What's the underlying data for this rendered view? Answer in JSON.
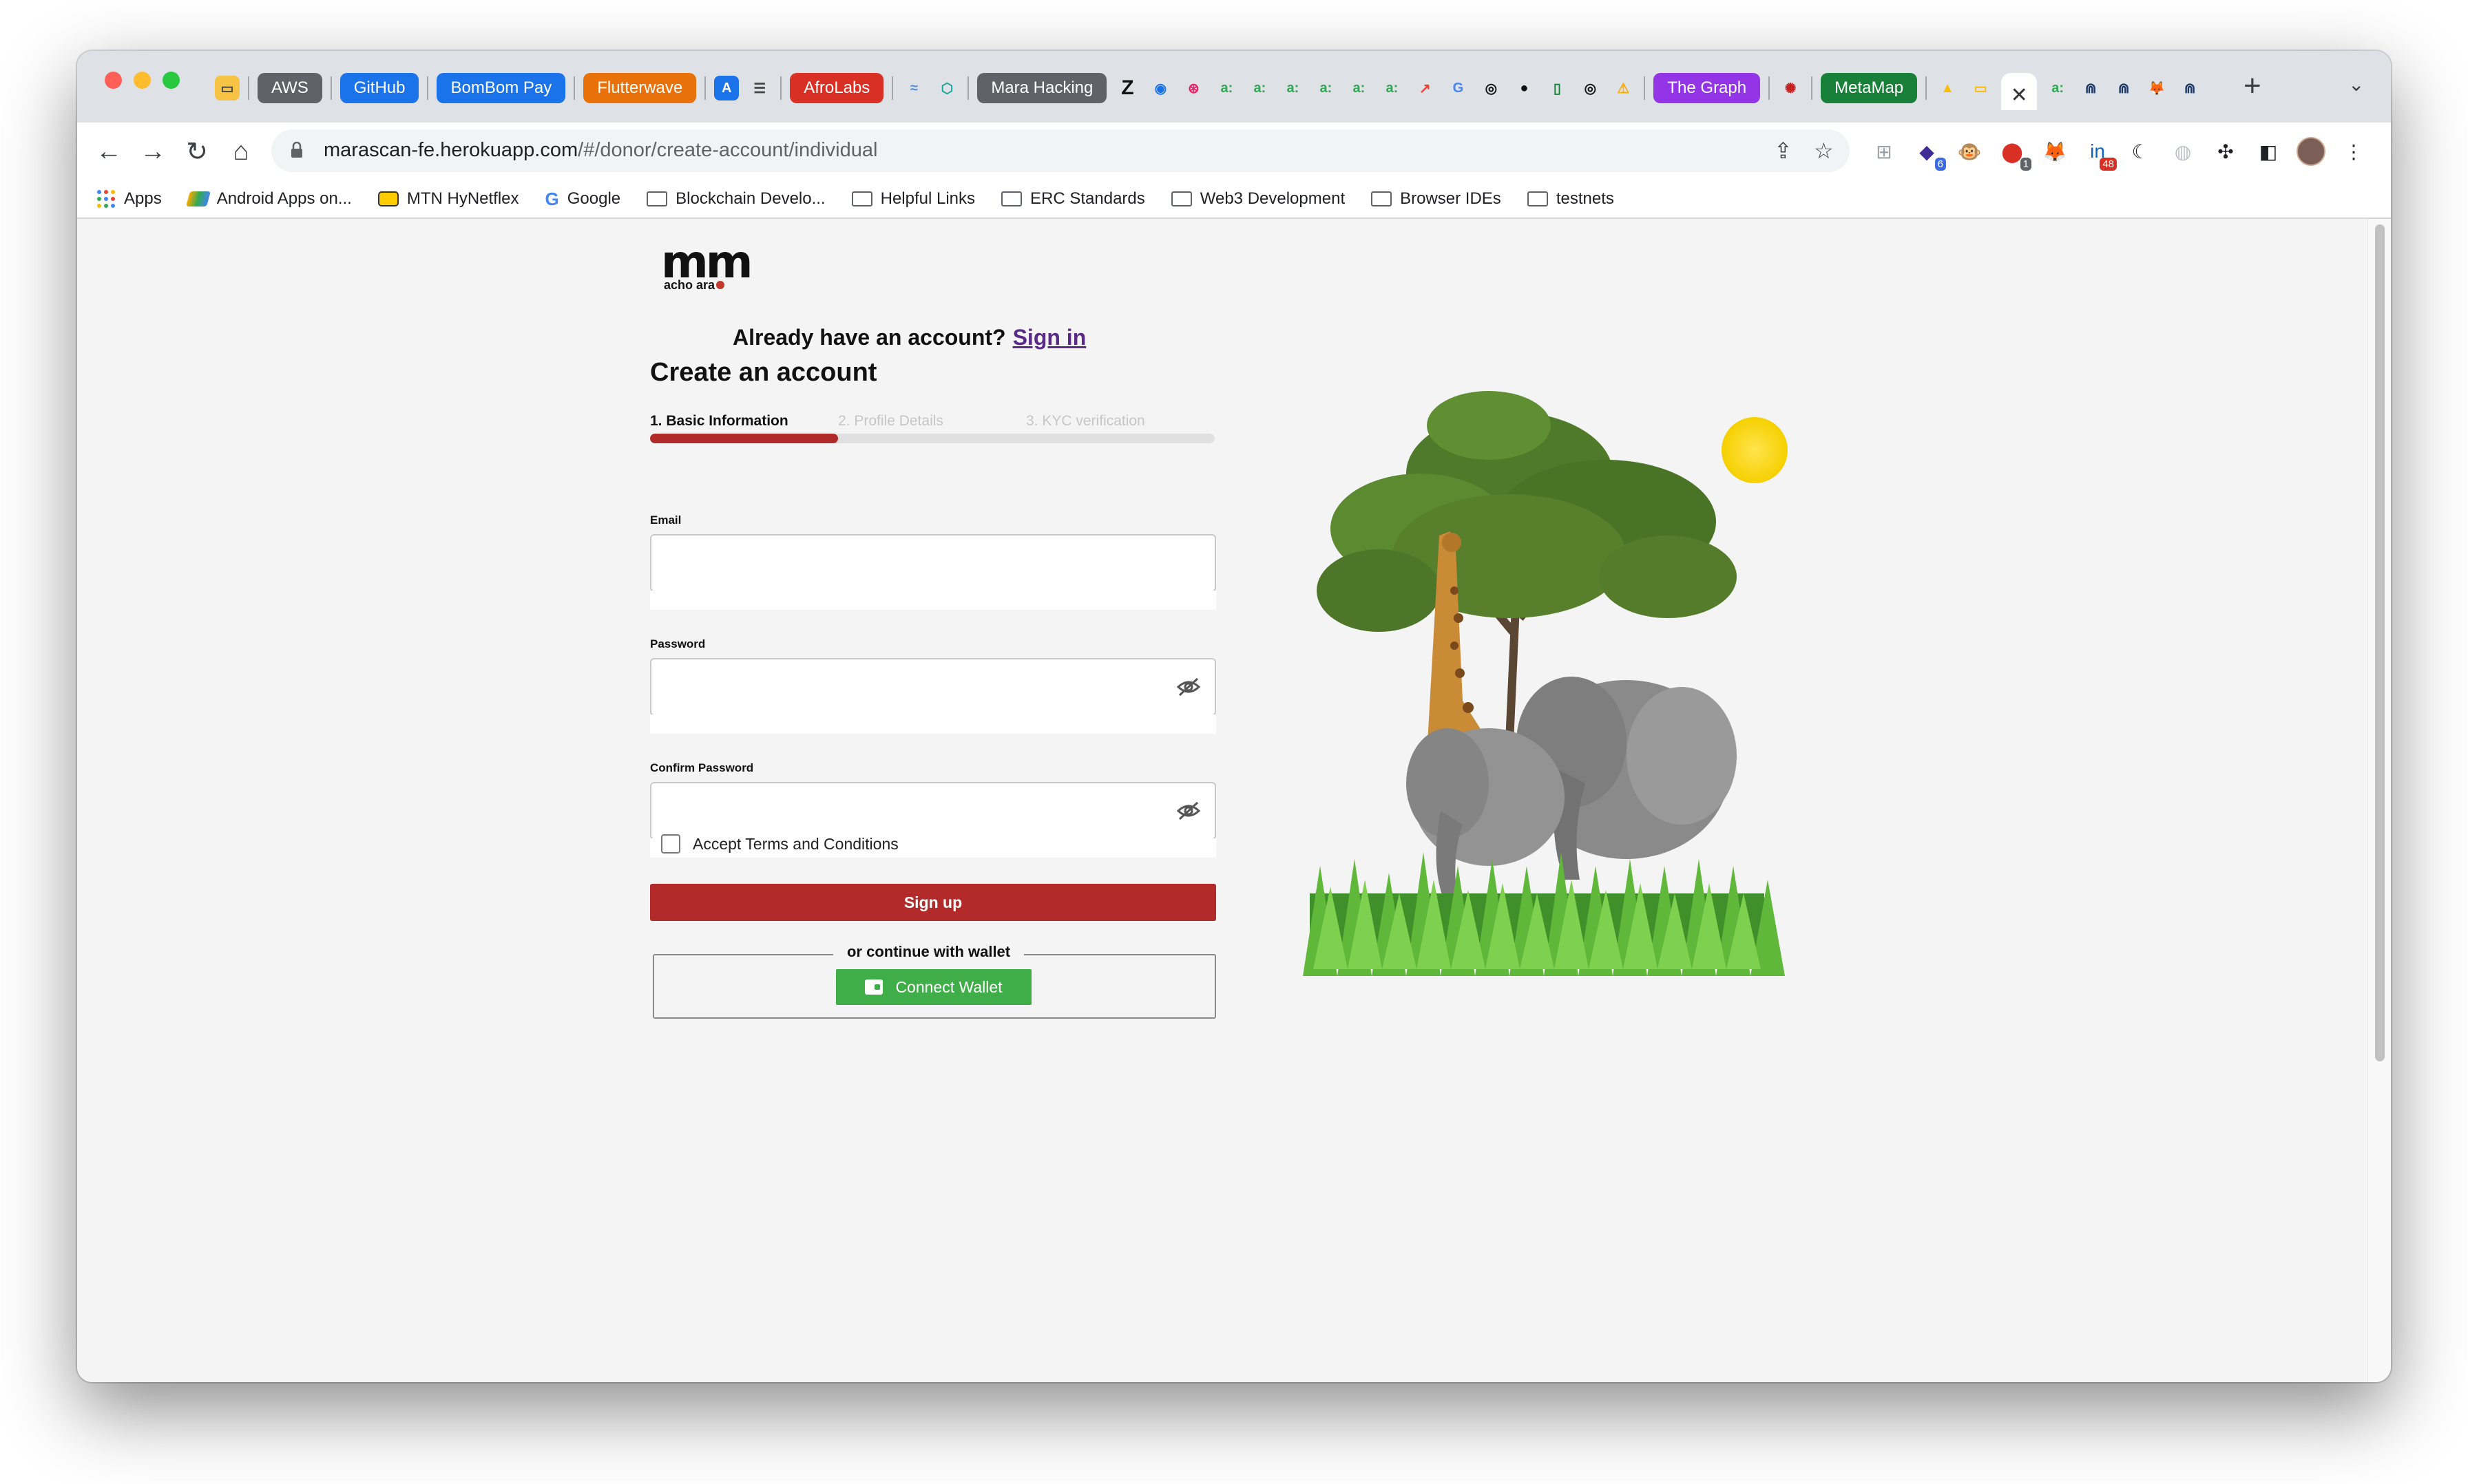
{
  "browser": {
    "tabs": [
      {
        "label": "AWS",
        "color": "#5f6368"
      },
      {
        "label": "GitHub",
        "color": "#1a73e8"
      },
      {
        "label": "BomBom Pay",
        "color": "#1a73e8"
      },
      {
        "label": "Flutterwave",
        "color": "#e8710a"
      },
      {
        "label": "AfroLabs",
        "color": "#d93025"
      },
      {
        "label": "Mara Hacking",
        "color": "#5f6368"
      },
      {
        "label": "The Graph",
        "color": "#9334e6"
      },
      {
        "label": "MetaMap",
        "color": "#188038"
      }
    ],
    "url_host": "marascan-fe.herokuapp.com",
    "url_path": "/#/donor/create-account/individual",
    "extension_badges": {
      "purple": "6",
      "red_one": "1",
      "linkedin": "48"
    },
    "bookmarks": [
      {
        "label": "Apps",
        "icon": "apps-grid-icon"
      },
      {
        "label": "Android Apps on...",
        "icon": "bluestacks-icon"
      },
      {
        "label": "MTN HyNetflex",
        "icon": "mtn-icon"
      },
      {
        "label": "Google",
        "icon": "google-icon"
      },
      {
        "label": "Blockchain Develo...",
        "icon": "folder-icon"
      },
      {
        "label": "Helpful Links",
        "icon": "folder-icon"
      },
      {
        "label": "ERC Standards",
        "icon": "folder-icon"
      },
      {
        "label": "Web3 Development",
        "icon": "folder-icon"
      },
      {
        "label": "Browser IDEs",
        "icon": "folder-icon"
      },
      {
        "label": "testnets",
        "icon": "folder-icon"
      }
    ]
  },
  "page": {
    "logo_big": "mm",
    "logo_small": "acho ara",
    "already_text": "Already have an account?",
    "signin_link": "Sign in",
    "title": "Create an account",
    "steps": [
      "1. Basic Information",
      "2. Profile Details",
      "3. KYC verification"
    ],
    "step_progress_fraction": 0.333,
    "email_label": "Email",
    "password_label": "Password",
    "confirm_password_label": "Confirm Password",
    "terms_label": "Accept Terms and Conditions",
    "signup_label": "Sign up",
    "wallet_divider": "or continue with wallet",
    "connect_wallet_label": "Connect Wallet",
    "colors": {
      "brand_red": "#b32a2a",
      "wallet_green": "#3fae49",
      "link_purple": "#5b2a86"
    }
  }
}
